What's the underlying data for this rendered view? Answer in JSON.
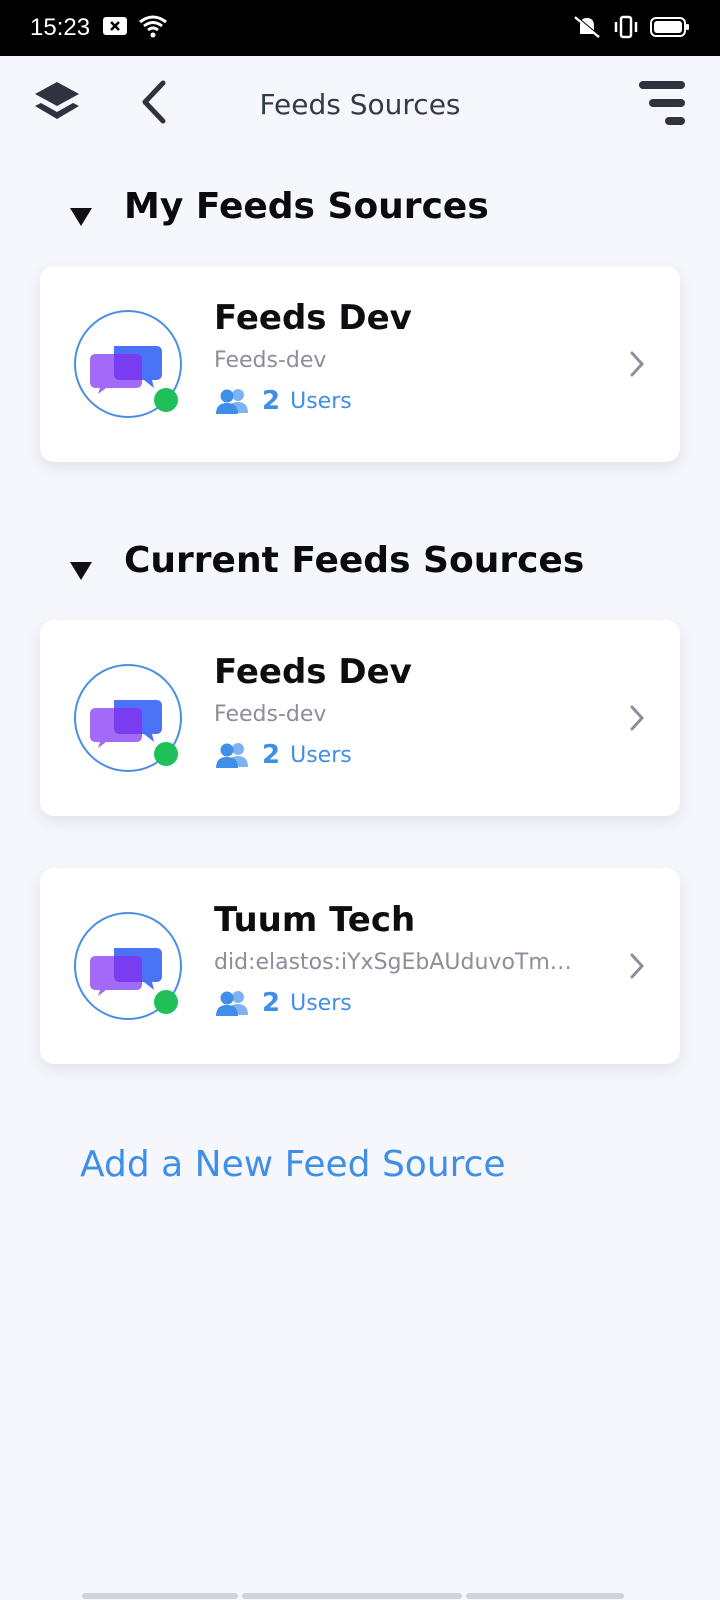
{
  "status_bar": {
    "time": "15:23",
    "icons": [
      "notification-x-icon",
      "wifi-icon",
      "mute-vibrate-icon",
      "vibrate-icon",
      "battery-icon"
    ]
  },
  "header": {
    "title": "Feeds Sources",
    "left_icons": [
      "layers-icon",
      "back-chevron-icon"
    ],
    "right_icon": "menu-icon"
  },
  "sections": [
    {
      "title": "My Feeds Sources",
      "cards": [
        {
          "name": "Feeds Dev",
          "subtitle": "Feeds-dev",
          "users_count": "2",
          "users_label": "Users",
          "online": true
        }
      ]
    },
    {
      "title": "Current Feeds Sources",
      "cards": [
        {
          "name": "Feeds Dev",
          "subtitle": "Feeds-dev",
          "users_count": "2",
          "users_label": "Users",
          "online": true
        },
        {
          "name": "Tuum Tech",
          "subtitle": "did:elastos:iYxSgEbAUduvoTmez...",
          "users_count": "2",
          "users_label": "Users",
          "online": true
        }
      ]
    }
  ],
  "add_link": "Add a New Feed Source",
  "colors": {
    "accent": "#3f8fe8",
    "online": "#1fc05a",
    "background": "#f6f7fc"
  }
}
